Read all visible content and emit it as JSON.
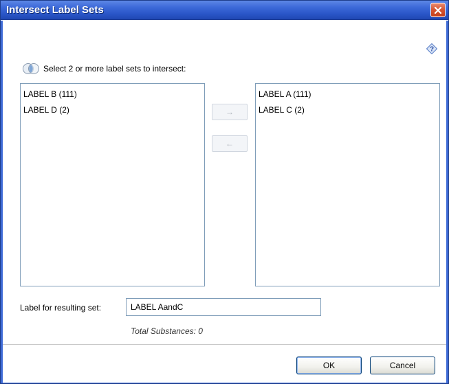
{
  "window": {
    "title": "Intersect Label Sets"
  },
  "instruction": "Select 2 or more label sets to intersect:",
  "available_list": {
    "items": [
      "LABEL B (111)",
      "LABEL D (2)"
    ]
  },
  "selected_list": {
    "items": [
      "LABEL A (111)",
      "LABEL C (2)"
    ]
  },
  "move_buttons": {
    "add": "→",
    "remove": "←"
  },
  "result": {
    "label": "Label for resulting set:",
    "value": "LABEL AandC"
  },
  "total": "Total Substances: 0",
  "buttons": {
    "ok": "OK",
    "cancel": "Cancel"
  },
  "icons": {
    "help": "help-icon",
    "venn": "venn-diagram-icon",
    "close": "close-icon"
  },
  "colors": {
    "titlebar": "#2a56c8",
    "close_button": "#d5532f",
    "list_border": "#7f9db9"
  }
}
